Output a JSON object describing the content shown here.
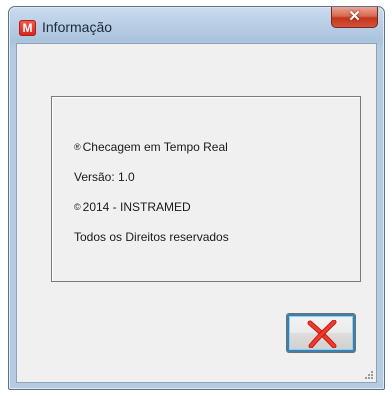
{
  "window": {
    "title": "Informação",
    "icon_letter": "M",
    "close_glyph": "✕"
  },
  "info": {
    "line1_symbol": "®",
    "line1_text": "Checagem em Tempo Real",
    "version": "Versão: 1.0",
    "copyright_symbol": "©",
    "copyright_text": "2014 - INSTRAMED",
    "rights": "Todos os Direitos reservados"
  },
  "buttons": {
    "cancel_icon": "red-x-icon"
  },
  "colors": {
    "x_red": "#e4231b",
    "focus_border": "#3c7fb1"
  }
}
